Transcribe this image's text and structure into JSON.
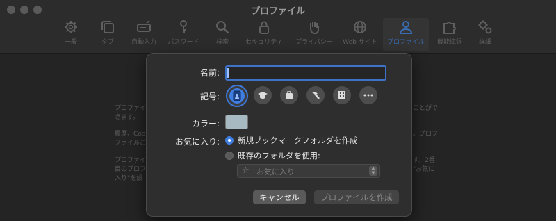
{
  "window": {
    "title": "プロファイル"
  },
  "toolbar": {
    "items": [
      {
        "label": "一般",
        "icon": "gear-icon"
      },
      {
        "label": "タブ",
        "icon": "tabs-icon"
      },
      {
        "label": "自動入力",
        "icon": "autofill-icon"
      },
      {
        "label": "パスワード",
        "icon": "key-icon"
      },
      {
        "label": "検索",
        "icon": "search-icon"
      },
      {
        "label": "セキュリティ",
        "icon": "lock-icon"
      },
      {
        "label": "プライバシー",
        "icon": "hand-icon"
      },
      {
        "label": "Web サイト",
        "icon": "globe-icon"
      },
      {
        "label": "プロファイル",
        "icon": "person-icon"
      },
      {
        "label": "機能拡張",
        "icon": "puzzle-icon"
      },
      {
        "label": "詳細",
        "icon": "gears-icon"
      }
    ]
  },
  "background_text": {
    "left_lines": [
      "プロファイ",
      "きます。",
      "履歴、Coo",
      "ファイルごと",
      "プロファイ",
      "目のプロフ",
      "入り\"を設"
    ],
    "right_lines": [
      "ことがで",
      "。プロフ",
      "す。2番",
      "\"お気に"
    ]
  },
  "dialog": {
    "name_label": "名前:",
    "name_value": "",
    "symbol_label": "記号:",
    "symbols": [
      "person-badge-icon",
      "graduation-cap-icon",
      "briefcase-icon",
      "hammer-icon",
      "building-icon",
      "more-icon"
    ],
    "color_label": "カラー:",
    "color_value": "#a7bac2",
    "favorites_label": "お気に入り:",
    "option_new": "新規ブックマークフォルダを作成",
    "option_existing": "既存のフォルダを使用:",
    "folder_popup": "お気に入り",
    "cancel_button": "キャンセル",
    "create_button": "プロファイルを作成"
  }
}
